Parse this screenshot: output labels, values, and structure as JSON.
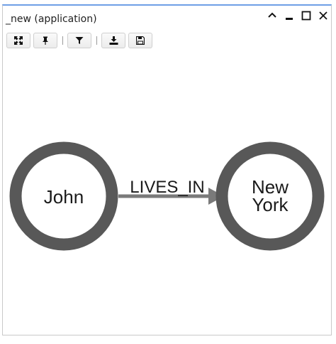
{
  "window": {
    "title": "_new (application)",
    "controls": [
      {
        "icon": "chevron-up-icon"
      },
      {
        "icon": "minimize-icon"
      },
      {
        "icon": "maximize-icon"
      },
      {
        "icon": "close-icon"
      }
    ]
  },
  "toolbar": {
    "buttons": [
      {
        "icon": "fit-view-icon"
      },
      {
        "icon": "pin-icon"
      },
      {
        "icon": "filter-icon"
      },
      {
        "icon": "download-icon"
      },
      {
        "icon": "save-icon"
      }
    ]
  },
  "graph": {
    "nodes": [
      {
        "id": "john",
        "label": "John"
      },
      {
        "id": "new-york",
        "label_line1": "New",
        "label_line2": "York"
      }
    ],
    "edges": [
      {
        "from": "john",
        "to": "new-york",
        "label": "LIVES_IN"
      }
    ]
  },
  "colors": {
    "node_ring": "#585858",
    "edge": "#7a7a7a",
    "text": "#1a1a1a",
    "title_border": "#6f9fe6"
  }
}
